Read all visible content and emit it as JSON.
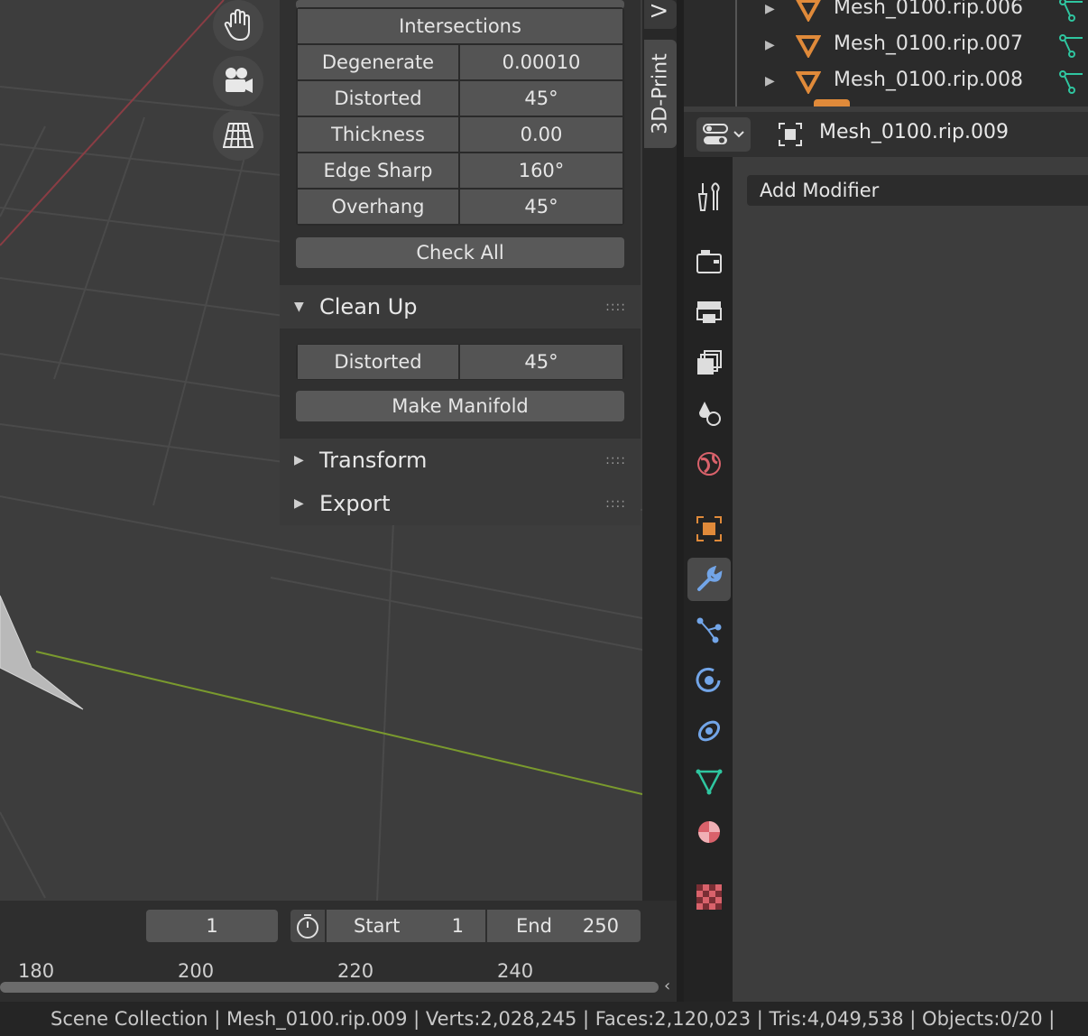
{
  "npanel": {
    "checks": {
      "intersections_label": "Intersections",
      "rows": [
        {
          "label": "Degenerate",
          "value": "0.00010"
        },
        {
          "label": "Distorted",
          "value": "45°"
        },
        {
          "label": "Thickness",
          "value": "0.00"
        },
        {
          "label": "Edge Sharp",
          "value": "160°"
        },
        {
          "label": "Overhang",
          "value": "45°"
        }
      ],
      "check_all_label": "Check All"
    },
    "cleanup": {
      "title": "Clean Up",
      "distorted_label": "Distorted",
      "distorted_value": "45°",
      "make_manifold_label": "Make Manifold"
    },
    "transform_title": "Transform",
    "export_title": "Export"
  },
  "tabs": {
    "view_partial": "V",
    "print3d": "3D-Print"
  },
  "outliner": {
    "items": [
      "Mesh_0100.rip.006",
      "Mesh_0100.rip.007",
      "Mesh_0100.rip.008"
    ]
  },
  "properties": {
    "object_name": "Mesh_0100.rip.009",
    "add_modifier_label": "Add Modifier"
  },
  "timeline": {
    "current_frame": "1",
    "start_label": "Start",
    "start_value": "1",
    "end_label": "End",
    "end_value": "250",
    "ticks": [
      "180",
      "200",
      "220",
      "240"
    ]
  },
  "statusbar": {
    "text": "Scene Collection | Mesh_0100.rip.009 | Verts:2,028,245 | Faces:2,120,023 | Tris:4,049,538 | Objects:0/20 |"
  },
  "colors": {
    "x_axis": "#8a3d44",
    "y_axis": "#7a9a2e",
    "mesh_orange": "#e08a3a",
    "active_tab_icon": "#72a5e8",
    "vertex_group_green": "#2fc6a0"
  }
}
